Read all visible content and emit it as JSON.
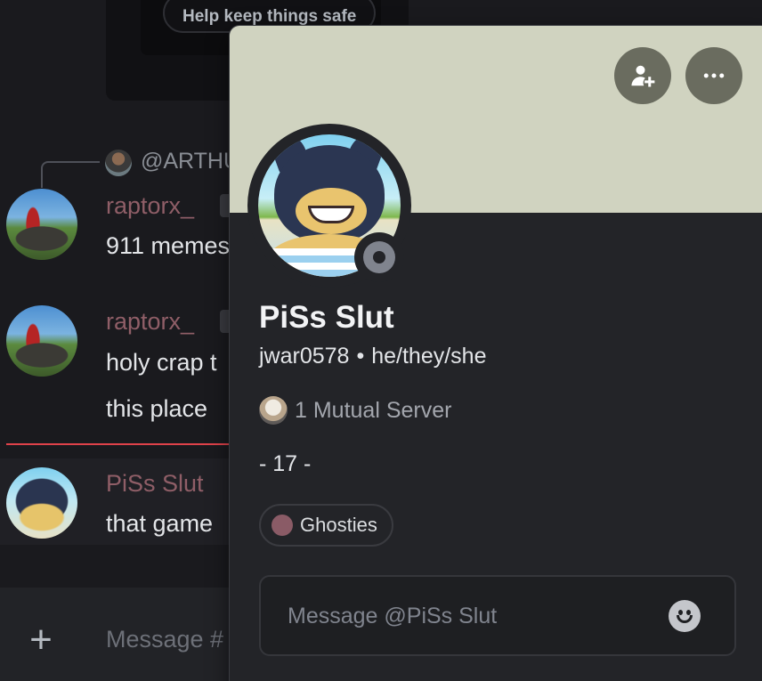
{
  "chat": {
    "safety_button_label": "Help keep things safe",
    "reply_name": "@ARTHU",
    "messages": [
      {
        "author": "raptorx_",
        "lines": [
          "911 memes"
        ]
      },
      {
        "author": "raptorx_",
        "lines": [
          "holy crap t",
          "this place"
        ]
      },
      {
        "author": "PiSs Slut",
        "lines": [
          "that game"
        ]
      }
    ],
    "input_placeholder": "Message #",
    "add_icon": "plus-icon"
  },
  "profile": {
    "banner_color": "#d0d3c0",
    "add_friend_icon": "add-friend-icon",
    "more_icon": "more-icon",
    "status": "offline",
    "display_name": "PiSs Slut",
    "username": "jwar0578",
    "separator": "•",
    "pronouns": "he/they/she",
    "mutual_servers": "1 Mutual Server",
    "bio": "- 17 -",
    "roles": [
      {
        "name": "Ghosties",
        "color": "#8a5b66"
      }
    ],
    "message_placeholder": "Message @PiSs Slut",
    "emoji_icon": "emoji-icon"
  },
  "colors": {
    "background": "#1a1a1e",
    "popout": "#232428",
    "author_name": "#8f5e67",
    "new_divider": "#e0424a"
  }
}
